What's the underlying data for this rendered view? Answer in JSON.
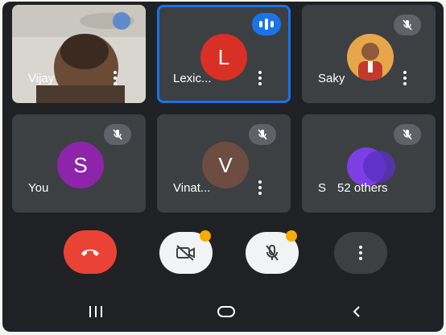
{
  "participants": [
    {
      "name": "Vijay",
      "menu_icon": "more-vert-icon"
    },
    {
      "name": "Lexic...",
      "initial": "L",
      "avatar_color": "#d93025",
      "speaking": true
    },
    {
      "name": "Saky",
      "muted": true
    },
    {
      "name": "You",
      "initial": "S",
      "avatar_color": "#8e24aa",
      "muted": true
    },
    {
      "name": "Vinat...",
      "initial": "V",
      "avatar_color": "#6d4c41",
      "muted": true
    },
    {
      "name": "S",
      "others_label": "52 others",
      "muted": true
    }
  ],
  "controls": {
    "hang_up": {
      "icon": "phone-hangup-icon",
      "color": "#ea4335"
    },
    "camera": {
      "icon": "camera-off-icon",
      "color": "#f1f3f4",
      "badge_color": "#f9ab00"
    },
    "microphone": {
      "icon": "mic-off-icon",
      "color": "#f1f3f4",
      "badge_color": "#f9ab00"
    },
    "more": {
      "icon": "more-vert-icon",
      "color": "#3c4043"
    }
  },
  "navbar": {
    "recents_icon": "recents-icon",
    "home_icon": "home-icon",
    "back_icon": "back-icon"
  },
  "colors": {
    "background": "#202124",
    "tile": "#3c4043",
    "active_border": "#1a73e8"
  }
}
